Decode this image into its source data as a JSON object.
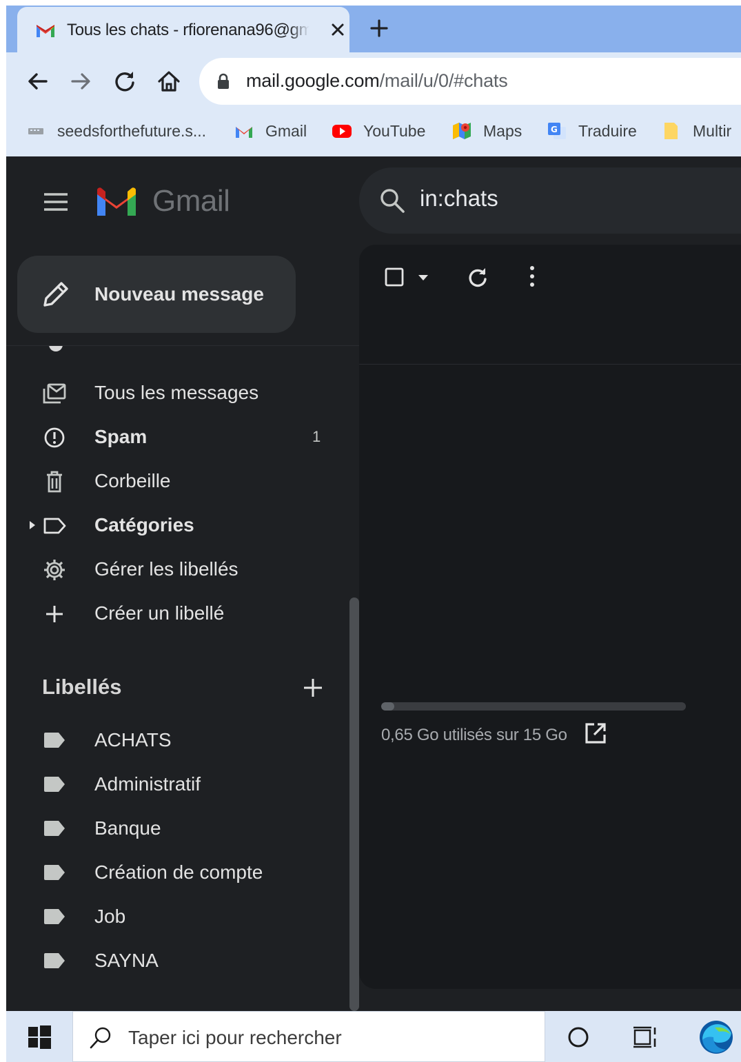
{
  "browser": {
    "tab_title": "Tous les chats - rfiorenana96@gmail.com",
    "url_host": "mail.google.com",
    "url_path": "/mail/u/0/#chats",
    "bookmarks": [
      {
        "label": "seedsforthefuture.s...",
        "icon": "site-icon"
      },
      {
        "label": "Gmail",
        "icon": "gmail-icon"
      },
      {
        "label": "YouTube",
        "icon": "youtube-icon"
      },
      {
        "label": "Maps",
        "icon": "maps-icon"
      },
      {
        "label": "Traduire",
        "icon": "translate-icon"
      },
      {
        "label": "Multir",
        "icon": "folder-icon"
      }
    ]
  },
  "gmail": {
    "logo_text": "Gmail",
    "search_query": "in:chats",
    "compose_label": "Nouveau message",
    "nav": [
      {
        "label": "Tous les messages",
        "count": "",
        "bold": false,
        "icon": "all-mail-icon"
      },
      {
        "label": "Spam",
        "count": "1",
        "bold": true,
        "icon": "spam-icon"
      },
      {
        "label": "Corbeille",
        "count": "",
        "bold": false,
        "icon": "trash-icon"
      },
      {
        "label": "Catégories",
        "count": "",
        "bold": true,
        "icon": "label-outline-icon"
      },
      {
        "label": "Gérer les libellés",
        "count": "",
        "bold": false,
        "icon": "gear-icon"
      },
      {
        "label": "Créer un libellé",
        "count": "",
        "bold": false,
        "icon": "plus-icon"
      }
    ],
    "labels_heading": "Libellés",
    "labels": [
      "ACHATS",
      "Administratif",
      "Banque",
      "Création de compte",
      "Job",
      "SAYNA"
    ],
    "storage": {
      "text": "0,65 Go utilisés sur 15 Go",
      "used_fraction": 0.043
    }
  },
  "taskbar": {
    "search_placeholder": "Taper ici pour rechercher"
  },
  "colors": {
    "background": "#1e2023",
    "main_panel": "#17191c",
    "text": "#e3e3e3",
    "tab_strip": "#89b0ec",
    "chrome": "#dee9f8"
  }
}
